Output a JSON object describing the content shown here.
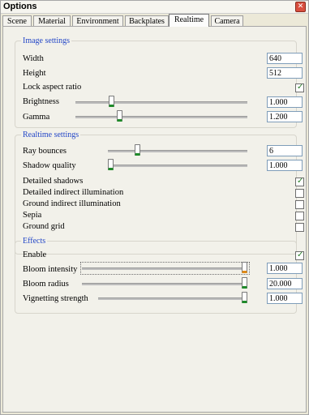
{
  "window": {
    "title": "Options"
  },
  "tabs": [
    "Scene",
    "Material",
    "Environment",
    "Backplates",
    "Realtime",
    "Camera"
  ],
  "active_tab": "Realtime",
  "image_settings": {
    "title": "Image settings",
    "width": {
      "label": "Width",
      "value": "640"
    },
    "height": {
      "label": "Height",
      "value": "512"
    },
    "lock_aspect": {
      "label": "Lock aspect ratio",
      "checked": true
    },
    "brightness": {
      "label": "Brightness",
      "value": "1.000",
      "level": 0.2
    },
    "gamma": {
      "label": "Gamma",
      "value": "1.200",
      "level": 0.25
    }
  },
  "realtime_settings": {
    "title": "Realtime settings",
    "ray_bounces": {
      "label": "Ray bounces",
      "value": "6",
      "level": 0.2
    },
    "shadow_quality": {
      "label": "Shadow quality",
      "value": "1.000",
      "level": 0.0
    },
    "detailed_shadows": {
      "label": "Detailed shadows",
      "checked": true
    },
    "detailed_indirect": {
      "label": "Detailed indirect illumination",
      "checked": false
    },
    "ground_indirect": {
      "label": "Ground indirect illumination",
      "checked": false
    },
    "sepia": {
      "label": "Sepia",
      "checked": false
    },
    "ground_grid": {
      "label": "Ground grid",
      "checked": false
    }
  },
  "effects": {
    "title": "Effects",
    "enable": {
      "label": "Enable",
      "checked": true
    },
    "bloom_intensity": {
      "label": "Bloom intensity",
      "value": "1.000",
      "level": 1.0
    },
    "bloom_radius": {
      "label": "Bloom radius",
      "value": "20.000",
      "level": 1.0
    },
    "vignetting": {
      "label": "Vignetting strength",
      "value": "1.000",
      "level": 1.0
    }
  }
}
